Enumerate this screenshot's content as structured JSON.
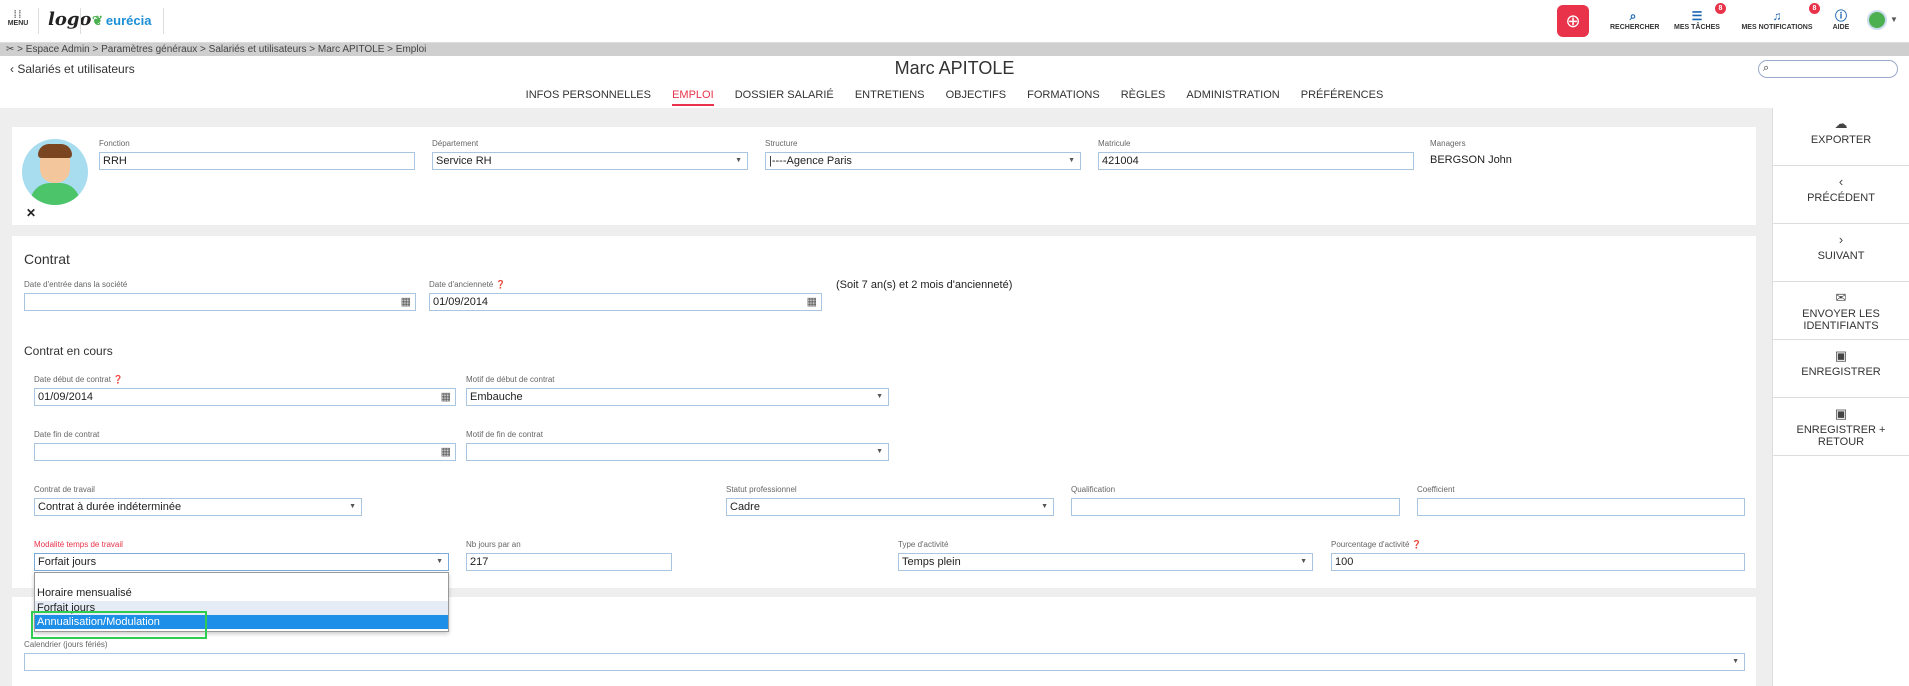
{
  "topbar": {
    "menu_label": "MENU",
    "logo_text": "logo",
    "brand": "eurécia",
    "tools": [
      {
        "label": "RECHERCHER",
        "icon": "search-icon"
      },
      {
        "label": "MES TÂCHES",
        "icon": "tasks-icon",
        "badge": "8"
      },
      {
        "label": "MES NOTIFICATIONS",
        "icon": "bell-icon",
        "badge": "8"
      },
      {
        "label": "AIDE",
        "icon": "help-icon"
      }
    ]
  },
  "breadcrumb": "Espace Admin > Paramètres généraux > Salariés et utilisateurs > Marc APITOLE > Emploi",
  "header": {
    "back_label": "Salariés et utilisateurs",
    "title": "Marc APITOLE",
    "search_placeholder": ""
  },
  "tabs": [
    {
      "label": "INFOS PERSONNELLES",
      "active": false
    },
    {
      "label": "EMPLOI",
      "active": true
    },
    {
      "label": "DOSSIER SALARIÉ",
      "active": false
    },
    {
      "label": "ENTRETIENS",
      "active": false
    },
    {
      "label": "OBJECTIFS",
      "active": false
    },
    {
      "label": "FORMATIONS",
      "active": false
    },
    {
      "label": "RÈGLES",
      "active": false
    },
    {
      "label": "ADMINISTRATION",
      "active": false
    },
    {
      "label": "PRÉFÉRENCES",
      "active": false
    }
  ],
  "actions": [
    {
      "label": "EXPORTER",
      "icon": "cloud-download-icon"
    },
    {
      "label": "PRÉCÉDENT",
      "icon": "chevron-left-icon"
    },
    {
      "label": "SUIVANT",
      "icon": "chevron-right-icon"
    },
    {
      "label": "ENVOYER LES IDENTIFIANTS",
      "icon": "envelope-icon"
    },
    {
      "label": "ENREGISTRER",
      "icon": "floppy-icon"
    },
    {
      "label": "ENREGISTRER + RETOUR",
      "icon": "floppy-back-icon"
    }
  ],
  "profile": {
    "fonction_label": "Fonction",
    "fonction_value": "RRH",
    "departement_label": "Département",
    "departement_value": "Service RH",
    "structure_label": "Structure",
    "structure_value": "|----Agence Paris",
    "matricule_label": "Matricule",
    "matricule_value": "421004",
    "managers_label": "Managers",
    "managers_value": "BERGSON John"
  },
  "contrat": {
    "title": "Contrat",
    "date_entree_label": "Date d'entrée dans la société",
    "date_entree_value": "",
    "date_anciennete_label": "Date d'ancienneté",
    "date_anciennete_value": "01/09/2014",
    "anciennete_text": "(Soit 7 an(s) et 2 mois d'ancienneté)"
  },
  "contrat_en_cours": {
    "title": "Contrat en cours",
    "date_debut_label": "Date début de contrat",
    "date_debut_value": "01/09/2014",
    "motif_debut_label": "Motif de début de contrat",
    "motif_debut_value": "Embauche",
    "date_fin_label": "Date fin de contrat",
    "date_fin_value": "",
    "motif_fin_label": "Motif de fin de contrat",
    "motif_fin_value": "",
    "contrat_travail_label": "Contrat de travail",
    "contrat_travail_value": "Contrat à durée indéterminée",
    "statut_label": "Statut professionnel",
    "statut_value": "Cadre",
    "qualification_label": "Qualification",
    "qualification_value": "",
    "coefficient_label": "Coefficient",
    "coefficient_value": "",
    "modalite_label": "Modalité temps de travail",
    "modalite_value": "Forfait jours",
    "nb_jours_label": "Nb jours par an",
    "nb_jours_value": "217",
    "type_activite_label": "Type d'activité",
    "type_activite_value": "Temps plein",
    "pourcentage_label": "Pourcentage d'activité",
    "pourcentage_value": "100"
  },
  "modalite_options": [
    "Horaire mensualisé",
    "Forfait jours",
    "Annualisation/Modulation"
  ],
  "calendrier": {
    "label": "Calendrier (jours fériés)",
    "value": ""
  }
}
